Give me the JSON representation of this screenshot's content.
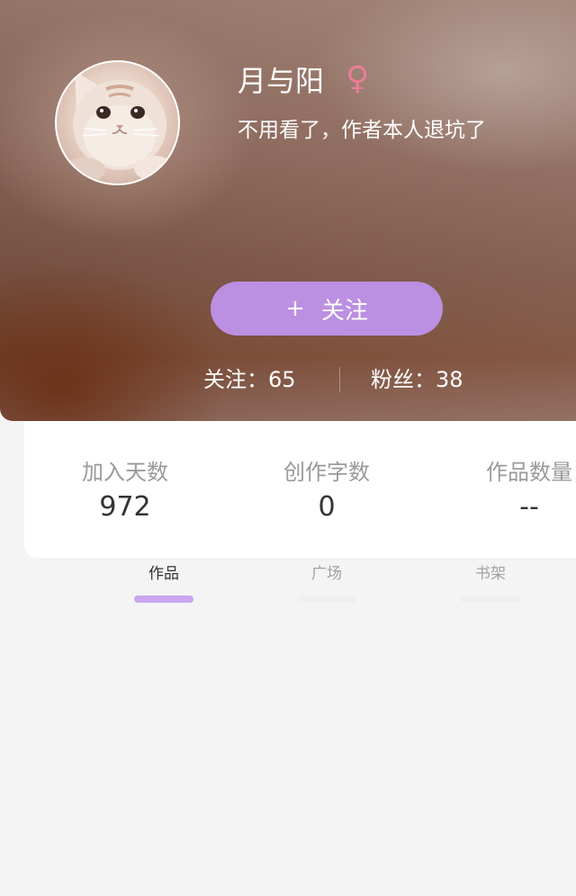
{
  "profile": {
    "nickname": "月与阳",
    "gender_symbol": "♀",
    "bio": "不用看了，作者本人退坑了",
    "follow_button": {
      "icon": "+",
      "label": "关注"
    },
    "following": "关注：65",
    "fans": "粉丝：38"
  },
  "stats": [
    {
      "label": "加入天数",
      "value": "972"
    },
    {
      "label": "创作字数",
      "value": "0"
    },
    {
      "label": "作品数量",
      "value": "--"
    }
  ],
  "tabs": [
    {
      "label": "作品",
      "active": true
    },
    {
      "label": "广场",
      "active": false
    },
    {
      "label": "书架",
      "active": false
    }
  ],
  "colors": {
    "accent": "#bb8fe2",
    "active_tab_indicator": "#c9a5ee",
    "gender_icon": "#e77e98",
    "background": "#f4f4f4"
  },
  "icons": {
    "gender": "female-symbol-icon",
    "follow": "plus-icon",
    "avatar": "cat-avatar"
  }
}
